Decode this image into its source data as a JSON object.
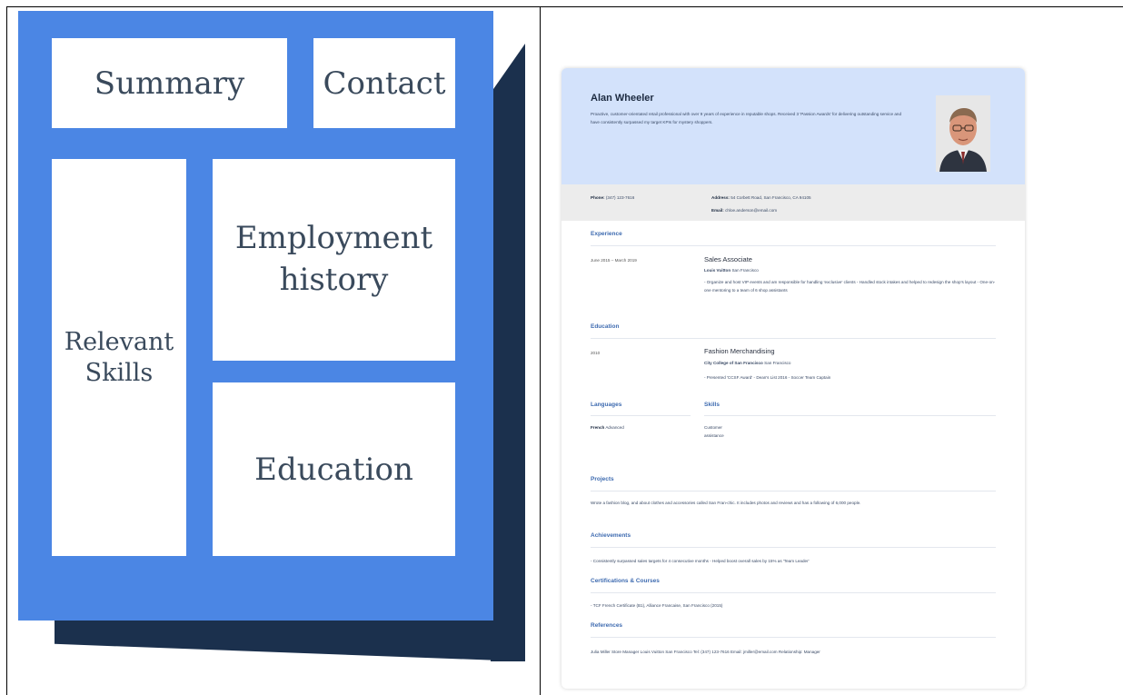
{
  "diagram": {
    "summary": "Summary",
    "contact": "Contact",
    "skills": "Relevant\nSkills",
    "employment": "Employment\nhistory",
    "education": "Education",
    "colors": {
      "card": "#4b86e4",
      "shadow": "#1b304d",
      "tile": "#ffffff"
    }
  },
  "resume": {
    "name": "Alan Wheeler",
    "summary": "Proactive, customer-orientated retail professional with over 9 years of experience in reputable shops. Received 3 'Passion Awards' for delivering outstanding service and have consistently surpassed my target KPIs for mystery shoppers.",
    "phone_label": "Phone:",
    "phone": "(347) 123-7616",
    "address_label": "Address:",
    "address": "54 Corbett Road, San Francisco, CA 94105",
    "email_label": "Email:",
    "email": "chloe.anderson@email.com",
    "sections": {
      "experience": "Experience",
      "education": "Education",
      "languages": "Languages",
      "skills": "Skills",
      "projects": "Projects",
      "achievements": "Achievements",
      "certifications": "Certifications & Courses",
      "references": "References"
    },
    "experience": {
      "dates": "June 2015 – March 2019",
      "title": "Sales Associate",
      "company": "Louis Vuitton",
      "location": "San Francisco",
      "description": "- Organize and host VIP events and am responsible for handling 'exclusive' clients - Handled stock intakes and helped to redesign the shop's layout - One-on-one mentoring to a team of 6 shop assistants"
    },
    "education": {
      "year": "2010",
      "title": "Fashion Merchandising",
      "school": "City College of San Francisco",
      "location": "San Francisco",
      "description": "- Presented 'CCSF Award' - Dean's List 2016 - Soccer Team Captain"
    },
    "language": {
      "name": "French",
      "level": "Advanced"
    },
    "skill": "Customer\nassistance",
    "projects": "Wrote a fashion blog, and about clothes and accessories called San Fran-chic. It includes photos and reviews and has a following of 6,000 people.",
    "achievements": "- Consistently surpassed sales targets for 4 consecutive months - Helped boost overall sales by 15% as 'Team Leader'",
    "certifications": "- TCF French Certificate (B1), Alliance Francaise, San Francisco (2015)",
    "references": "Julia Miller Store Manager Louis Vuitton San Francisco Tel: (347) 123-7616 Email: jmiller@email.com Relationship: Manager"
  }
}
